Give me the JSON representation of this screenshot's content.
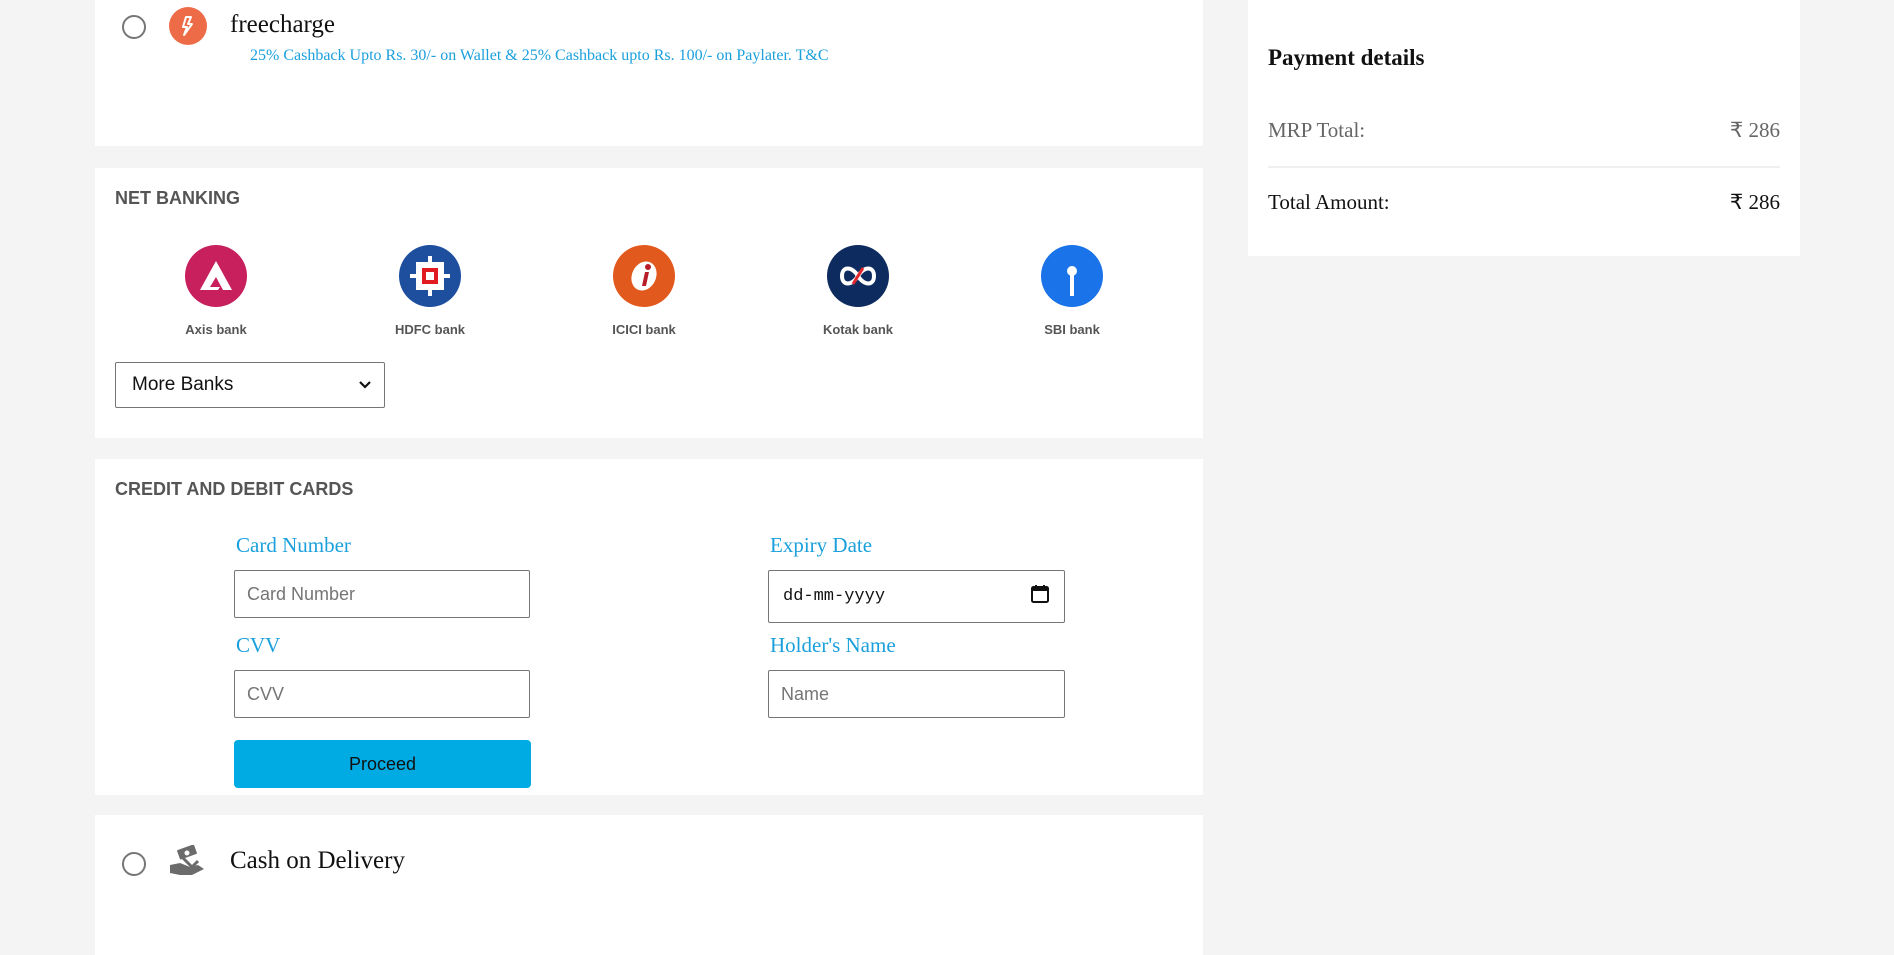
{
  "wallet": {
    "name": "freecharge",
    "offer": "25% Cashback Upto Rs. 30/- on Wallet & 25% Cashback upto Rs. 100/- on Paylater. T&C"
  },
  "net_banking": {
    "title": "NET BANKING",
    "banks": [
      {
        "name": "Axis bank",
        "color": "#c8205c"
      },
      {
        "name": "HDFC bank",
        "color": "#1d4f9e"
      },
      {
        "name": "ICICI bank",
        "color": "#e2591e"
      },
      {
        "name": "Kotak bank",
        "color": "#0d2b5e"
      },
      {
        "name": "SBI bank",
        "color": "#1a73e8"
      }
    ],
    "more_banks": "More Banks"
  },
  "cards": {
    "title": "CREDIT AND DEBIT CARDS",
    "card_number_label": "Card Number",
    "card_number_placeholder": "Card Number",
    "expiry_label": "Expiry Date",
    "expiry_placeholder": "dd-mm-yyyy",
    "cvv_label": "CVV",
    "cvv_placeholder": "CVV",
    "holder_label": "Holder's Name",
    "holder_placeholder": "Name",
    "proceed": "Proceed"
  },
  "cod": {
    "label": "Cash on Delivery"
  },
  "payment_details": {
    "title": "Payment details",
    "mrp_label": "MRP Total:",
    "mrp_value": "₹ 286",
    "total_label": "Total Amount:",
    "total_value": "₹ 286"
  },
  "colors": {
    "accent": "#00abe4",
    "link": "#1ba0dc",
    "freecharge": "#ed6c47"
  }
}
